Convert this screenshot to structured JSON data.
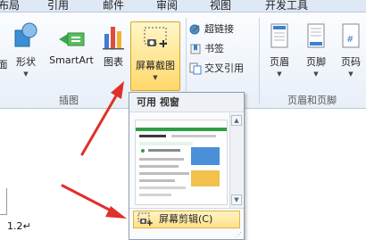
{
  "tabs": [
    {
      "label": "布局"
    },
    {
      "label": "引用"
    },
    {
      "label": "邮件"
    },
    {
      "label": "审阅"
    },
    {
      "label": "视图"
    },
    {
      "label": "开发工具"
    }
  ],
  "insert_group": {
    "label": "插图",
    "buttons": {
      "partial": "面",
      "shape": "形状",
      "smartart": "SmartArt",
      "chart": "图表",
      "screenshot": "屏幕截图"
    }
  },
  "links_group": {
    "hyperlink": "超链接",
    "bookmark": "书签",
    "crossref": "交叉引用"
  },
  "header_footer_group": {
    "label": "页眉和页脚",
    "header": "页眉",
    "footer": "页脚",
    "page_number": "页码"
  },
  "dropdown": {
    "header": "可用 视窗",
    "clip_item": "屏幕剪辑(C)"
  },
  "document": {
    "text": "1.2↵"
  },
  "colors": {
    "highlight": "#ffd86a",
    "arrow": "#e0302a"
  }
}
